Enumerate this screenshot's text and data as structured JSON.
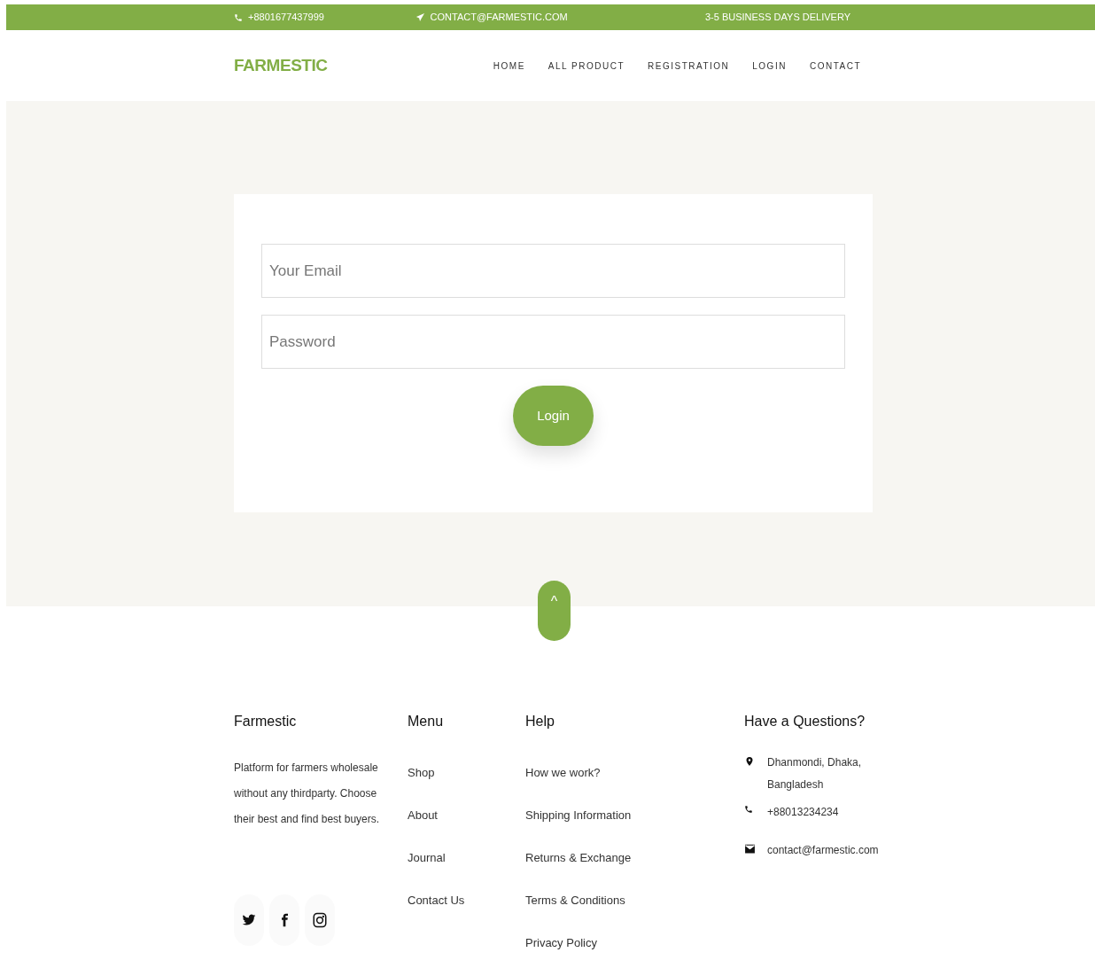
{
  "top_bar": [
    {
      "kind": "phone",
      "text": "+8801677437999"
    },
    {
      "kind": "email",
      "text": "CONTACT@FARMESTIC.COM"
    },
    {
      "kind": "plain",
      "text": "3-5 BUSINESS DAYS DELIVERY"
    }
  ],
  "header": {
    "logo": "FARMESTIC",
    "nav": [
      "HOME",
      "ALL PRODUCT",
      "REGISTRATION",
      "LOGIN",
      "CONTACT"
    ]
  },
  "login_form": {
    "fields": [
      {
        "placeholder": "Your Email"
      },
      {
        "placeholder": "Password"
      }
    ],
    "button": "Login"
  },
  "scroll_top": "^",
  "footer": {
    "about": {
      "title": "Farmestic",
      "text": "Platform for farmers wholesale without any thirdparty. Choose their best and find best buyers.",
      "social": [
        {
          "kind": "twitter"
        },
        {
          "kind": "facebook"
        },
        {
          "kind": "instagram"
        }
      ]
    },
    "menu": {
      "title": "Menu",
      "links": [
        "Shop",
        "About",
        "Journal",
        "Contact Us"
      ]
    },
    "help": {
      "title": "Help",
      "links": [
        "How we work?",
        "Shipping Information",
        "Returns & Exchange",
        "Terms & Conditions",
        "Privacy Policy"
      ]
    },
    "contact": {
      "title": "Have a Questions?",
      "items": [
        {
          "kind": "address",
          "text": "Dhanmondi, Dhaka, Bangladesh"
        },
        {
          "kind": "phone",
          "text": "+88013234234"
        },
        {
          "kind": "email",
          "text": "contact@farmestic.com"
        }
      ]
    }
  }
}
